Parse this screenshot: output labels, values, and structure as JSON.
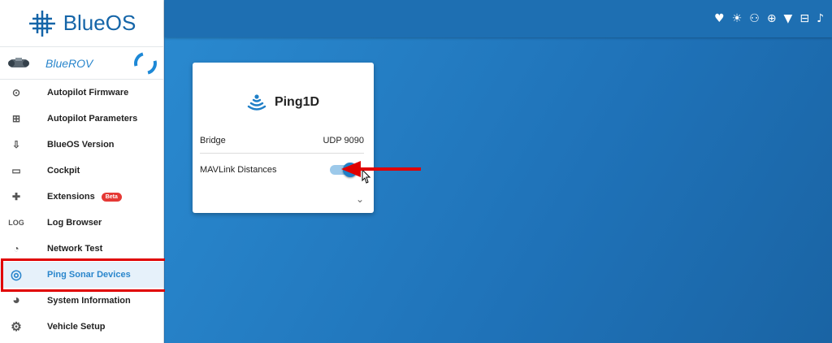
{
  "app": {
    "logo_text": "BlueOS"
  },
  "vehicle": {
    "name": "BlueROV"
  },
  "sidebar": {
    "items": [
      {
        "label": "Autopilot Firmware",
        "icon": "target-icon",
        "glyph": "⊙"
      },
      {
        "label": "Autopilot Parameters",
        "icon": "table-icon",
        "glyph": "⊞"
      },
      {
        "label": "BlueOS Version",
        "icon": "download-icon",
        "glyph": "⇩"
      },
      {
        "label": "Cockpit",
        "icon": "gamepad-icon",
        "glyph": "▭"
      },
      {
        "label": "Extensions",
        "icon": "puzzle-icon",
        "glyph": "✚",
        "badge": "Beta"
      },
      {
        "label": "Log Browser",
        "icon": "log-icon",
        "glyph": "LOG"
      },
      {
        "label": "Network Test",
        "icon": "speedometer-icon",
        "glyph": "◔"
      },
      {
        "label": "Ping Sonar Devices",
        "icon": "sonar-icon",
        "glyph": "◎",
        "active": true
      },
      {
        "label": "System Information",
        "icon": "pie-chart-icon",
        "glyph": "◕"
      },
      {
        "label": "Vehicle Setup",
        "icon": "gear-icon",
        "glyph": "⚙"
      }
    ]
  },
  "topbar": {
    "icons": [
      "heart-pulse-icon",
      "sun-icon",
      "robot-icon",
      "globe-icon",
      "wifi-icon",
      "network-icon",
      "bell-icon"
    ],
    "glyphs": [
      "♥",
      "☀",
      "⚇",
      "⊕",
      "▼",
      "⊟",
      "♪"
    ]
  },
  "card": {
    "title": "Ping1D",
    "bridge_label": "Bridge",
    "bridge_value": "UDP 9090",
    "mavlink_label": "MAVLink Distances",
    "mavlink_enabled": true,
    "expand_glyph": "⌄"
  },
  "colors": {
    "accent": "#1f7fc7",
    "highlight": "#e00000",
    "background": "#1f6fb0"
  }
}
